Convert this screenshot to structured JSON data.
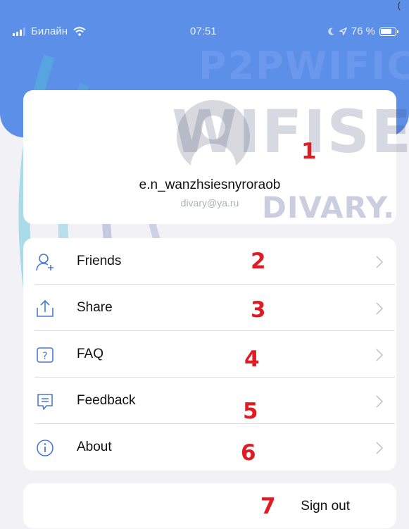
{
  "status_bar": {
    "carrier": "Билайн",
    "time": "07:51",
    "battery": "76 %"
  },
  "corner_mark": "(",
  "profile": {
    "username": "e.n_wanzhsiesnyroraob",
    "email": "divary@ya.ru"
  },
  "menu": {
    "items": [
      {
        "label": "Friends",
        "icon": "add-friend-icon"
      },
      {
        "label": "Share",
        "icon": "share-icon"
      },
      {
        "label": "FAQ",
        "icon": "faq-icon"
      },
      {
        "label": "Feedback",
        "icon": "feedback-icon"
      },
      {
        "label": "About",
        "icon": "info-icon"
      }
    ]
  },
  "signout": {
    "label": "Sign out"
  },
  "annotations": [
    "1",
    "2",
    "3",
    "4",
    "5",
    "6",
    "7"
  ],
  "watermarks": {
    "top": "P2PWIFIC",
    "middle": "WIFISE",
    "lower": "DIVARY."
  },
  "colors": {
    "header_blue": "#5b8fe8",
    "background": "#f2f2f6",
    "annotation_red": "#e01b24",
    "icon_blue": "#4a78d8"
  }
}
